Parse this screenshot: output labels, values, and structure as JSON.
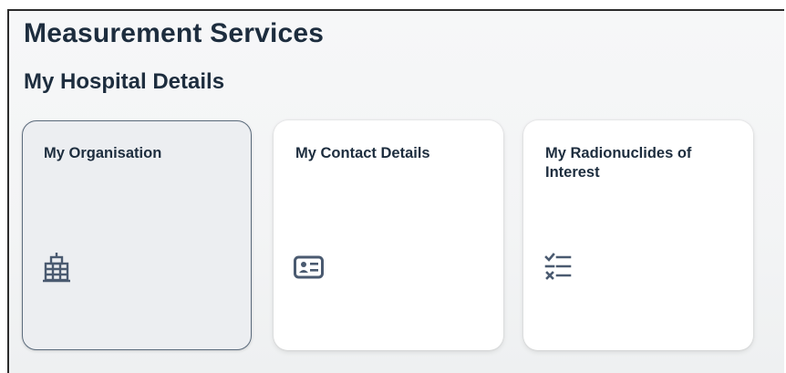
{
  "header": {
    "title": "Measurement Services"
  },
  "section": {
    "title": "My Hospital Details"
  },
  "tiles": [
    {
      "title": "My Organisation",
      "icon": "building-icon",
      "selected": true
    },
    {
      "title": "My Contact Details",
      "icon": "contact-card-icon",
      "selected": false
    },
    {
      "title": "My Radionuclides of Interest",
      "icon": "checklist-icon",
      "selected": false
    }
  ],
  "colors": {
    "text": "#1d2d3e",
    "icon": "#4a5a70",
    "tile_background": "#ffffff",
    "selected_tile_background": "#eceef1",
    "selected_tile_border": "#5b6b7c"
  }
}
